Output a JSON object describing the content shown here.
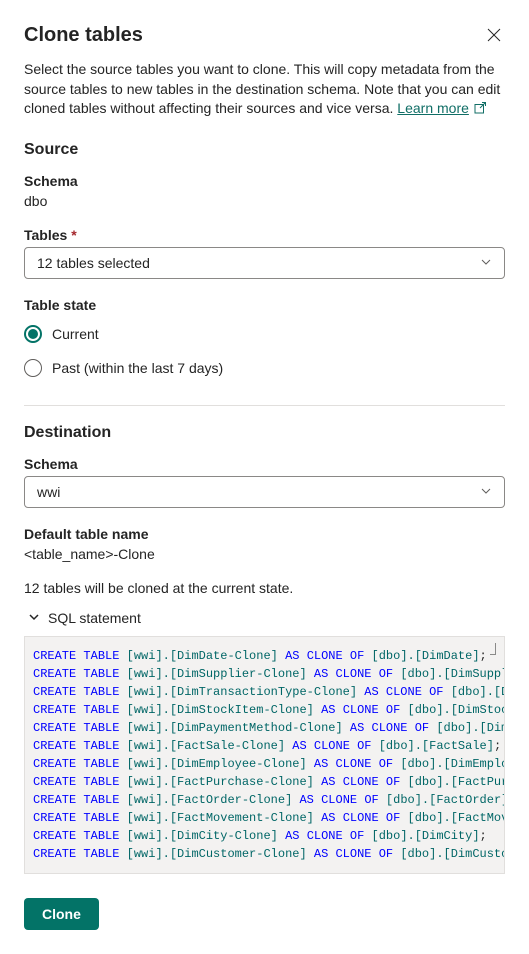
{
  "header": {
    "title": "Clone tables"
  },
  "intro": {
    "text": "Select the source tables you want to clone. This will copy metadata from the source tables to new tables in the destination schema. Note that you can edit cloned tables without affecting their sources and vice versa. ",
    "link_label": "Learn more"
  },
  "source": {
    "heading": "Source",
    "schema_label": "Schema",
    "schema_value": "dbo",
    "tables_label": "Tables",
    "tables_selected": "12 tables selected",
    "table_state_label": "Table state",
    "state_current": "Current",
    "state_past": "Past (within the last 7 days)"
  },
  "destination": {
    "heading": "Destination",
    "schema_label": "Schema",
    "schema_value": "wwi",
    "default_name_label": "Default table name",
    "default_name_value": "<table_name>-Clone"
  },
  "status": {
    "summary": "12 tables will be cloned at the current state."
  },
  "sql": {
    "header": "SQL statement",
    "statements": [
      {
        "dest": "[wwi].[DimDate-Clone]",
        "src": "[dbo].[DimDate]"
      },
      {
        "dest": "[wwi].[DimSupplier-Clone]",
        "src": "[dbo].[DimSupplier]"
      },
      {
        "dest": "[wwi].[DimTransactionType-Clone]",
        "src": "[dbo].[DimTra"
      },
      {
        "dest": "[wwi].[DimStockItem-Clone]",
        "src": "[dbo].[DimStockItem"
      },
      {
        "dest": "[wwi].[DimPaymentMethod-Clone]",
        "src": "[dbo].[DimPayme"
      },
      {
        "dest": "[wwi].[FactSale-Clone]",
        "src": "[dbo].[FactSale]"
      },
      {
        "dest": "[wwi].[DimEmployee-Clone]",
        "src": "[dbo].[DimEmployee]"
      },
      {
        "dest": "[wwi].[FactPurchase-Clone]",
        "src": "[dbo].[FactPurchase"
      },
      {
        "dest": "[wwi].[FactOrder-Clone]",
        "src": "[dbo].[FactOrder]"
      },
      {
        "dest": "[wwi].[FactMovement-Clone]",
        "src": "[dbo].[FactMovement"
      },
      {
        "dest": "[wwi].[DimCity-Clone]",
        "src": "[dbo].[DimCity]"
      },
      {
        "dest": "[wwi].[DimCustomer-Clone]",
        "src": "[dbo].[DimCustomer]"
      }
    ],
    "terminated": [
      true,
      true,
      false,
      false,
      false,
      true,
      true,
      false,
      true,
      false,
      true,
      true
    ]
  },
  "actions": {
    "clone": "Clone"
  }
}
